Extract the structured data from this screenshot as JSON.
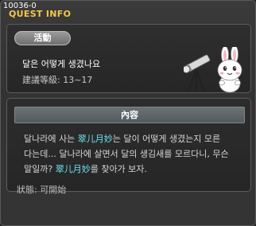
{
  "window": {
    "id": "10036-0",
    "title": "QUEST INFO"
  },
  "summary": {
    "category": "活動",
    "quest_name": "달은 어떻게 생겼나요",
    "level_range": "建議等級: 13~17"
  },
  "detail": {
    "header": "內容",
    "line1_a": "달나라에 사는 ",
    "line1_npc": "翠儿月妙",
    "line1_b": "는 달이 어떻게 생겼는지 모른",
    "line2": "다는데... 달나라에 살면서 달의 생김새를 모르다니, 무슨",
    "line3_a": "말일까? ",
    "line3_npc": "翠儿月妙",
    "line3_b": "를 찾아가 보자."
  },
  "status": {
    "text": "狀態:  可開始"
  },
  "icons": {
    "npc": "bunny-with-telescope"
  },
  "colors": {
    "title": "#f2c84a",
    "npc_highlight": "#6fe3f0"
  }
}
